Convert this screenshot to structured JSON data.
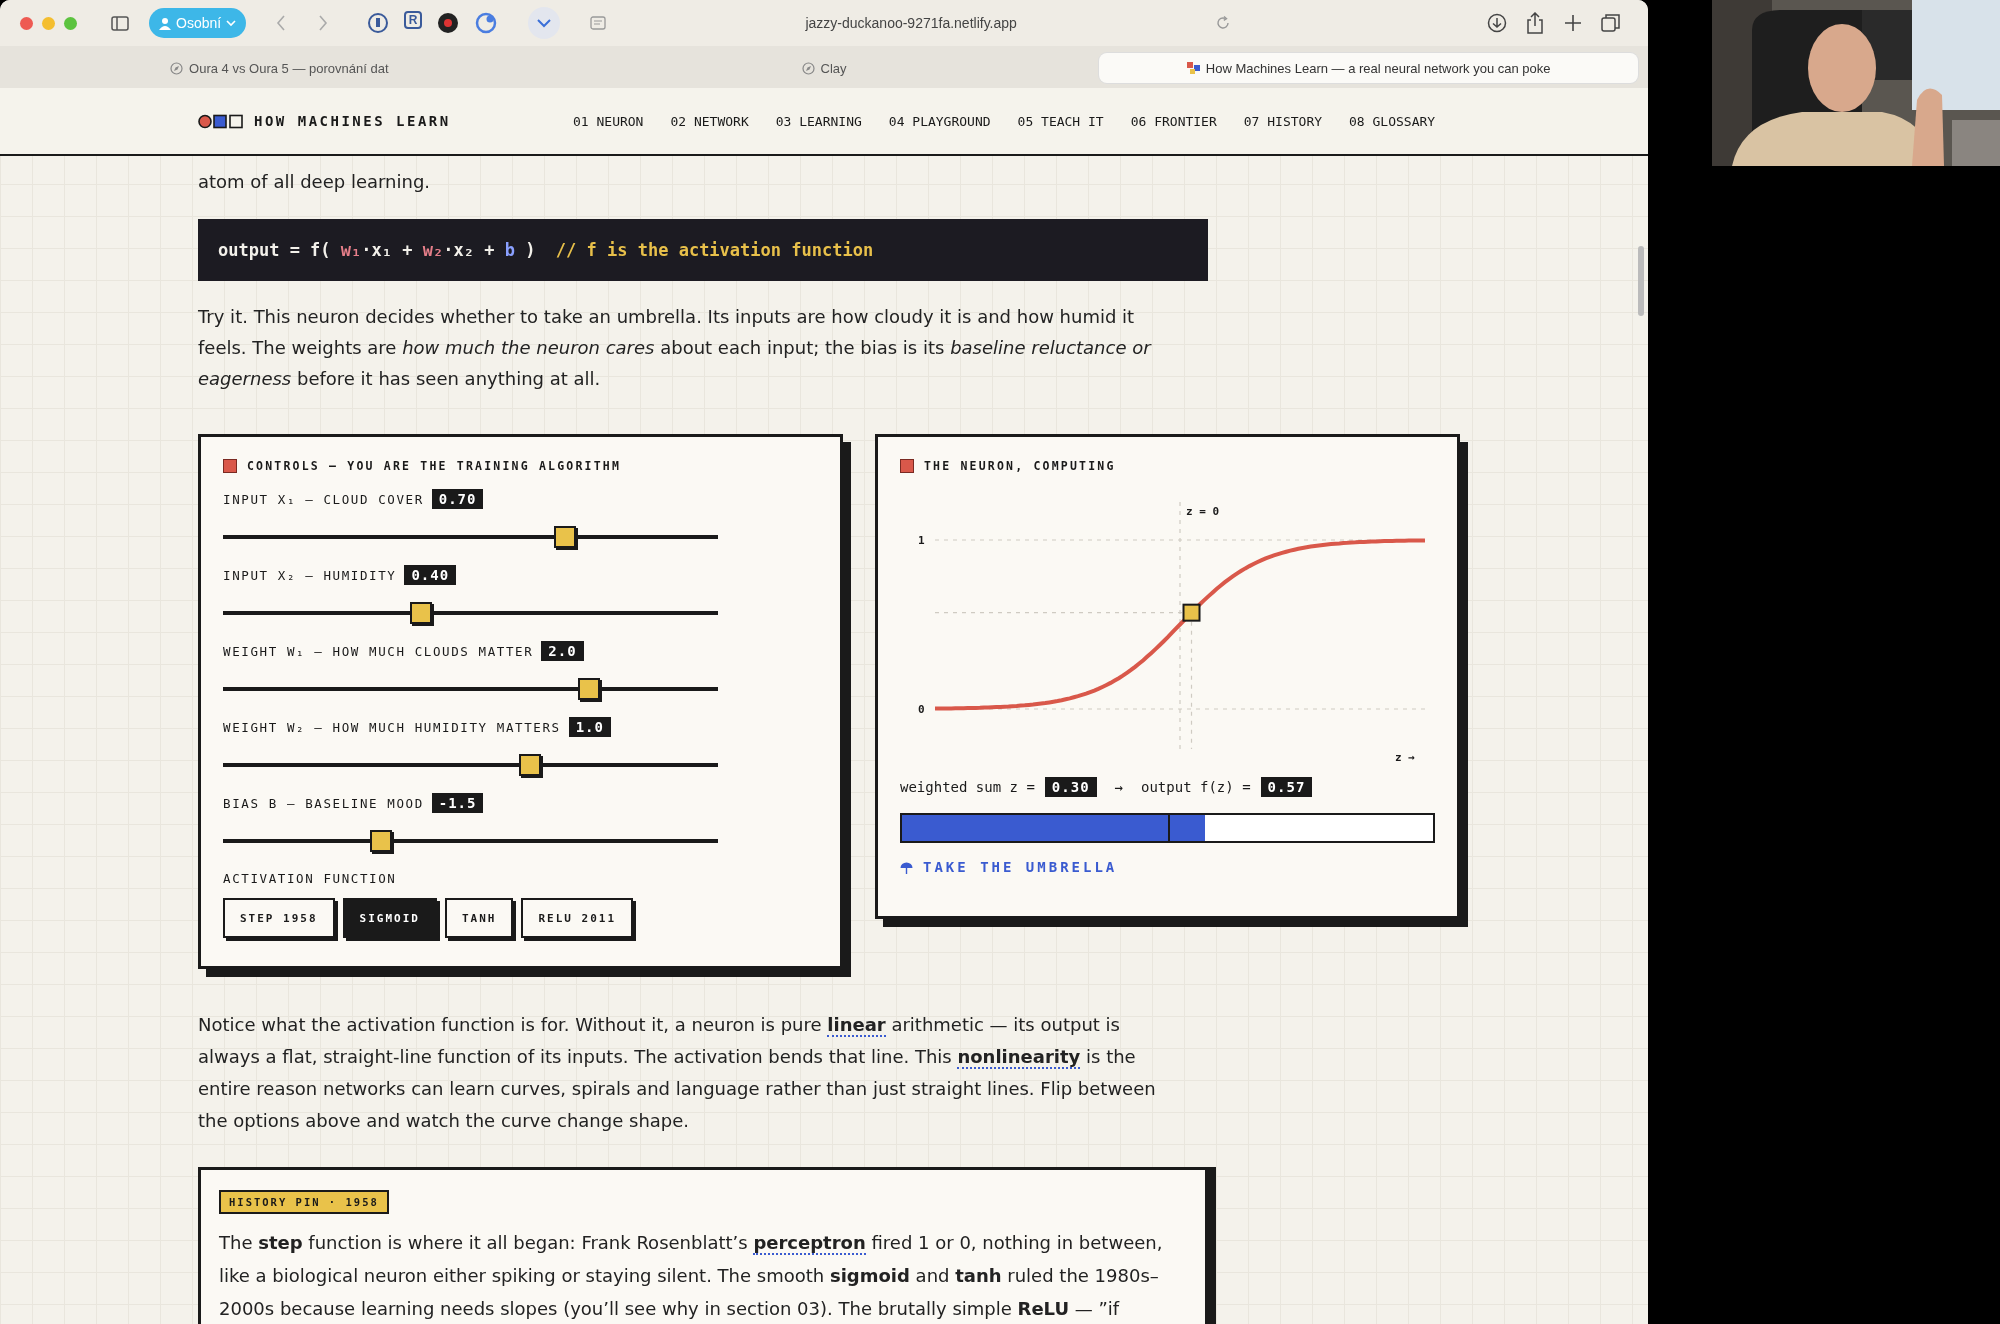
{
  "browser": {
    "profile": "Osobní",
    "extension_badge": "R",
    "url": "jazzy-duckanoo-9271fa.netlify.app",
    "tabs": [
      {
        "title": "Oura 4 vs Oura 5 — porovnání dat",
        "selected": false
      },
      {
        "title": "Clay",
        "selected": false
      },
      {
        "title": "How Machines Learn — a real neural network you can poke",
        "selected": true
      }
    ]
  },
  "site": {
    "logo": "HOW MACHINES LEARN",
    "nav": [
      "01 NEURON",
      "02 NETWORK",
      "03 LEARNING",
      "04 PLAYGROUND",
      "05 TEACH IT",
      "06 FRONTIER",
      "07 HISTORY",
      "08 GLOSSARY"
    ]
  },
  "intro_tail": "atom of all deep learning.",
  "code": [
    {
      "kind": "plain",
      "text": "output = f( "
    },
    {
      "kind": "weight",
      "text": "w₁"
    },
    {
      "kind": "plain",
      "text": "·x₁ + "
    },
    {
      "kind": "weight",
      "text": "w₂"
    },
    {
      "kind": "plain",
      "text": "·x₂ + "
    },
    {
      "kind": "bias",
      "text": "b"
    },
    {
      "kind": "plain",
      "text": " )  "
    },
    {
      "kind": "comment",
      "text": "// f is the activation function"
    }
  ],
  "intro": "Try it. This neuron decides whether to take an umbrella. Its inputs are how cloudy it is and how humid it feels. The weights are *how much the neuron cares* about each input; the bias is its *baseline reluctance or eagerness* before it has seen anything at all.",
  "controls": {
    "title": "CONTROLS — YOU ARE THE TRAINING ALGORITHM",
    "sliders": [
      {
        "label": "INPUT X₁ — CLOUD COVER",
        "reading": "0.70",
        "level": 0.69
      },
      {
        "label": "INPUT X₂ — HUMIDITY",
        "reading": "0.40",
        "level": 0.4
      },
      {
        "label": "WEIGHT W₁ — HOW MUCH CLOUDS MATTER",
        "reading": "2.0",
        "level": 0.74
      },
      {
        "label": "WEIGHT W₂ — HOW MUCH HUMIDITY MATTERS",
        "reading": "1.0",
        "level": 0.62
      },
      {
        "label": "BIAS B — BASELINE MOOD",
        "reading": "-1.5",
        "level": 0.32
      }
    ],
    "activation_label": "ACTIVATION FUNCTION",
    "activations": [
      {
        "label": "STEP 1958",
        "selected": false
      },
      {
        "label": "SIGMOID",
        "selected": true
      },
      {
        "label": "TANH",
        "selected": false
      },
      {
        "label": "RELU 2011",
        "selected": false
      }
    ]
  },
  "neuron": {
    "title": "THE NEURON, COMPUTING",
    "plot": {
      "top_tick": "1",
      "bottom_tick": "0",
      "zero_label": "z = 0",
      "axis_label": "z →"
    },
    "sum_label": "weighted sum z =",
    "sum": "0.30",
    "arrow": "→",
    "output_label": "output f(z) =",
    "output": "0.57",
    "level": 0.57,
    "verdict": "TAKE THE UMBRELLA"
  },
  "notice": [
    {
      "kind": "text",
      "text": "Notice what the activation function is for. Without it, a neuron is pure "
    },
    {
      "kind": "link",
      "text": "linear"
    },
    {
      "kind": "text",
      "text": " arithmetic — its output is always a flat, straight-line function of its inputs. The activation bends that line. This "
    },
    {
      "kind": "link",
      "text": "nonlinearity"
    },
    {
      "kind": "text",
      "text": " is the entire reason networks can learn curves, spirals and language rather than just straight lines. Flip between the options above and watch the curve change shape."
    }
  ],
  "history": {
    "badge": "HISTORY PIN · 1958",
    "body": [
      {
        "kind": "text",
        "text": "The **step** function is where it all began: Frank Rosenblatt’s "
      },
      {
        "kind": "link",
        "text": "perceptron"
      },
      {
        "kind": "text",
        "text": " fired 1 or 0, nothing in between, like a biological neuron either spiking or staying silent. The smooth **sigmoid** and **tanh** ruled the 1980s–2000s because learning needs slopes (you’ll see why in section 03). The brutally simple **ReLU** — ”if"
      }
    ]
  }
}
